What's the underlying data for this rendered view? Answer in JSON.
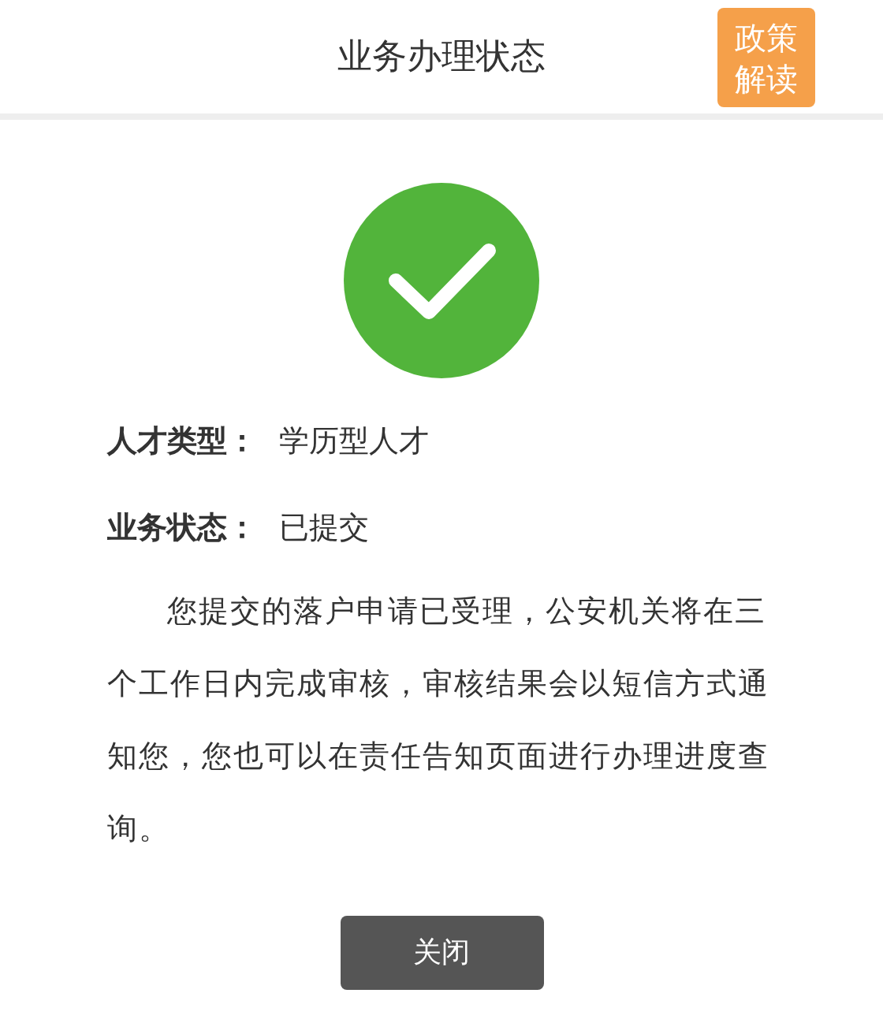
{
  "header": {
    "title": "业务办理状态",
    "policy_button": "政策解读"
  },
  "status": {
    "success": true
  },
  "fields": [
    {
      "label": "人才类型：",
      "value": "学历型人才"
    },
    {
      "label": "业务状态：",
      "value": "已提交"
    }
  ],
  "message": "您提交的落户申请已受理，公安机关将在三个工作日内完成审核，审核结果会以短信方式通知您，您也可以在责任告知页面进行办理进度查询。",
  "buttons": [
    "关闭"
  ]
}
